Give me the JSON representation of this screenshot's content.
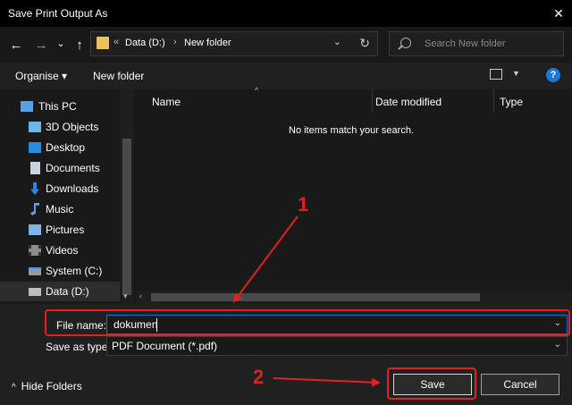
{
  "window": {
    "title": "Save Print Output As",
    "close_glyph": "✕"
  },
  "nav": {
    "back_glyph": "←",
    "forward_glyph": "→",
    "recent_glyph": "⌄",
    "up_glyph": "↑",
    "address": {
      "prefix": "«",
      "segments": [
        "Data (D:)",
        "New folder"
      ],
      "separator": "›",
      "dropdown_glyph": "⌄",
      "refresh_glyph": "↻"
    },
    "search": {
      "placeholder": "Search New folder"
    }
  },
  "toolbar": {
    "organise_label": "Organise ▾",
    "new_folder_label": "New folder",
    "view_dd": "▼",
    "help_label": "?"
  },
  "sidebar": {
    "items": [
      {
        "label": "This PC",
        "icon": "pc-icon",
        "color": "#5aa0e6"
      },
      {
        "label": "3D Objects",
        "icon": "cube-icon",
        "color": "#6cb6f0"
      },
      {
        "label": "Desktop",
        "icon": "desktop-icon",
        "color": "#2b8be0"
      },
      {
        "label": "Documents",
        "icon": "documents-icon",
        "color": "#c9d4e0"
      },
      {
        "label": "Downloads",
        "icon": "downloads-icon",
        "color": "#2f86e0"
      },
      {
        "label": "Music",
        "icon": "music-icon",
        "color": "#5aa0e6"
      },
      {
        "label": "Pictures",
        "icon": "pictures-icon",
        "color": "#7fb4e8"
      },
      {
        "label": "Videos",
        "icon": "videos-icon",
        "color": "#8c8c8c"
      },
      {
        "label": "System (C:)",
        "icon": "drive-c-icon",
        "color": "#9a9a9a"
      },
      {
        "label": "Data (D:)",
        "icon": "drive-d-icon",
        "color": "#bdbdbd"
      }
    ]
  },
  "content": {
    "columns": [
      "Name",
      "Date modified",
      "Type"
    ],
    "sort_glyph": "^",
    "empty_message": "No items match your search."
  },
  "form": {
    "file_name_label": "File name:",
    "file_name_value": "dokumen",
    "save_type_label": "Save as type:",
    "save_type_value": "PDF Document (*.pdf)",
    "dropdown_glyph": "⌄"
  },
  "footer": {
    "hide_folders_label": "Hide Folders",
    "hide_chev": "^",
    "save_label": "Save",
    "cancel_label": "Cancel"
  },
  "annotations": {
    "num1": "1",
    "num2": "2",
    "color": "#e31f1f"
  }
}
